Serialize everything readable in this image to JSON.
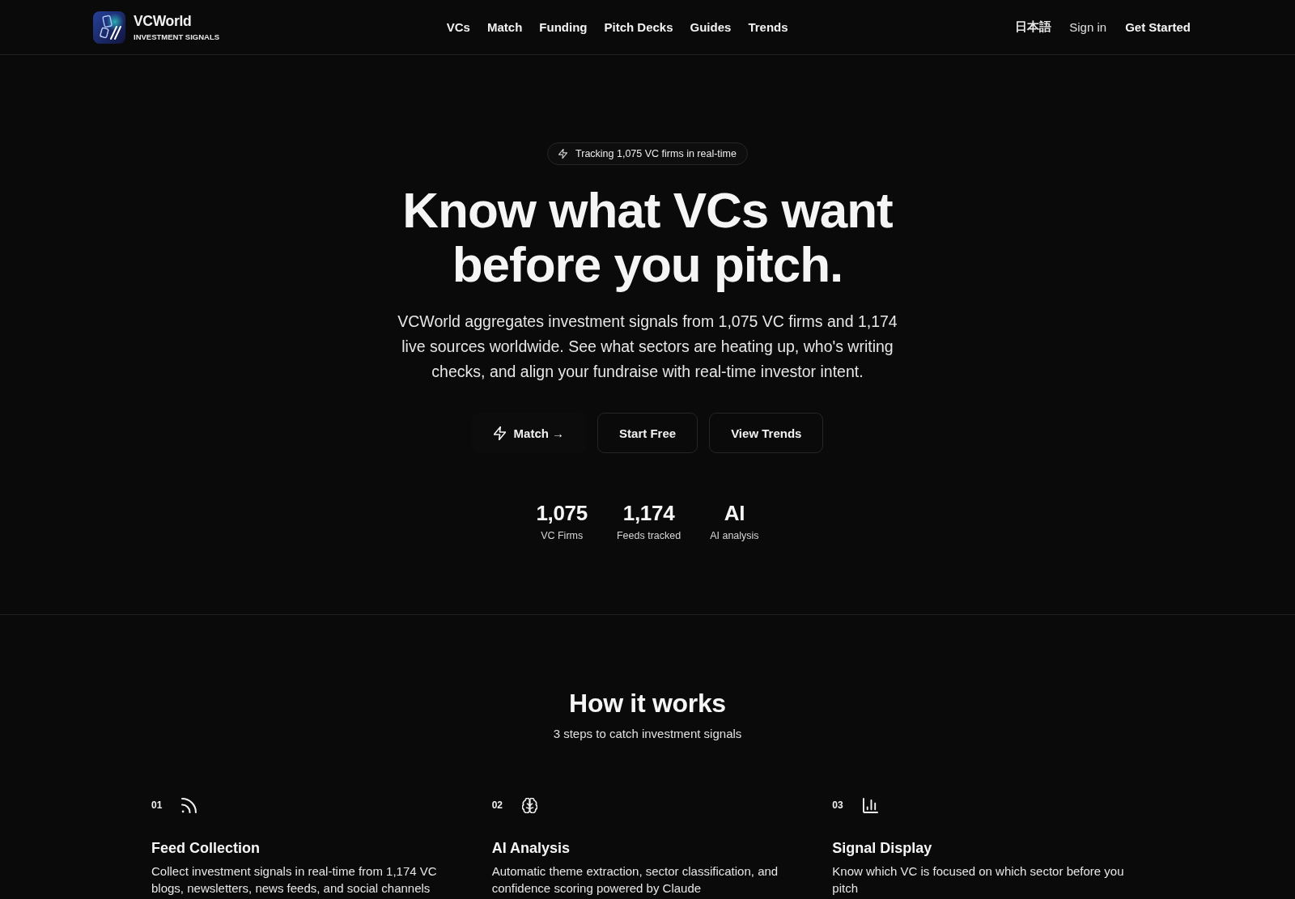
{
  "header": {
    "brand": {
      "name": "VCWorld",
      "tagline": "INVESTMENT SIGNALS"
    },
    "nav": [
      "VCs",
      "Match",
      "Funding",
      "Pitch Decks",
      "Guides",
      "Trends"
    ],
    "language": "日本語",
    "sign_in": "Sign in",
    "get_started": "Get Started"
  },
  "hero": {
    "badge": "Tracking 1,075 VC firms in real-time",
    "title": "Know what VCs want before you pitch.",
    "description": "VCWorld aggregates investment signals from 1,075 VC firms and 1,174 live sources worldwide. See what sectors are heating up, who's writing checks, and align your fundraise with real-time investor intent.",
    "buttons": [
      {
        "label": "Match →",
        "kind": "link"
      },
      {
        "label": "Start Free",
        "kind": "outlined"
      },
      {
        "label": "View Trends",
        "kind": "outlined"
      }
    ],
    "stats": [
      {
        "value": "1,075",
        "label": "VC Firms"
      },
      {
        "value": "1,174",
        "label": "Feeds tracked"
      },
      {
        "value": "AI",
        "label": "AI analysis"
      }
    ]
  },
  "how_it_works": {
    "title": "How it works",
    "subtitle": "3 steps to catch investment signals",
    "steps": [
      {
        "number": "01",
        "title": "Feed Collection",
        "description": "Collect investment signals in real-time from 1,174 VC blogs, newsletters, news feeds, and social channels"
      },
      {
        "number": "02",
        "title": "AI Analysis",
        "description": "Automatic theme extraction, sector classification, and confidence scoring powered by Claude"
      },
      {
        "number": "03",
        "title": "Signal Display",
        "description": "Know which VC is focused on which sector before you pitch"
      }
    ]
  }
}
